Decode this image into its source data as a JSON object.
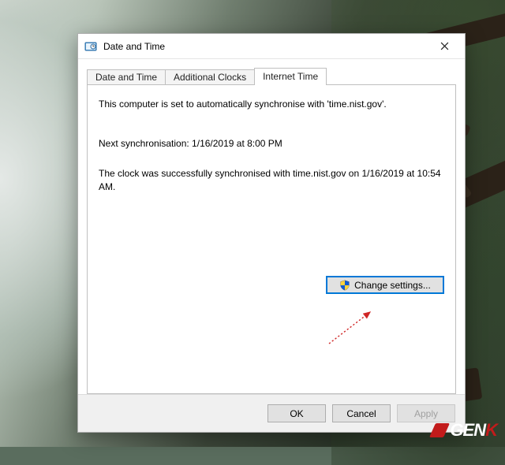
{
  "window": {
    "title": "Date and Time"
  },
  "tabs": {
    "items": [
      {
        "label": "Date and Time"
      },
      {
        "label": "Additional Clocks"
      },
      {
        "label": "Internet Time"
      }
    ],
    "active_index": 2
  },
  "panel": {
    "line1": "This computer is set to automatically synchronise with 'time.nist.gov'.",
    "line2": "Next synchronisation: 1/16/2019 at 8:00 PM",
    "line3": "The clock was successfully synchronised with time.nist.gov on 1/16/2019 at 10:54 AM.",
    "change_settings_label": "Change settings..."
  },
  "buttons": {
    "ok": "OK",
    "cancel": "Cancel",
    "apply": "Apply"
  },
  "watermark": {
    "brand": "GENK"
  }
}
